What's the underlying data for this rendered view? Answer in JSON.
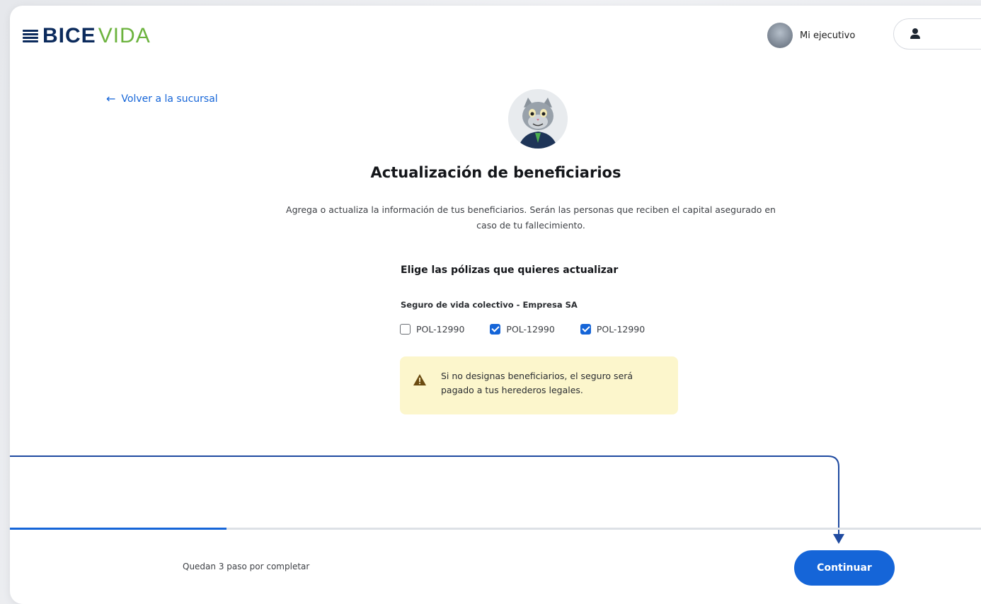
{
  "header": {
    "logo_part1": "BICE",
    "logo_part2": "VIDA",
    "executive_label": "Mi ejecutivo"
  },
  "nav": {
    "back_label": "Volver a la sucursal"
  },
  "main": {
    "title": "Actualización de beneficiarios",
    "description": "Agrega o actualiza la información de tus beneficiarios. Serán las personas que reciben el capital asegurado en caso de tu fallecimiento.",
    "section_title": "Elige las pólizas que quieres actualizar",
    "policy_group": "Seguro de vida colectivo - Empresa SA",
    "policies": [
      {
        "label": "POL-12990",
        "checked": false
      },
      {
        "label": "POL-12990",
        "checked": true
      },
      {
        "label": "POL-12990",
        "checked": true
      }
    ],
    "alert_text": "Si no designas beneficiarios, el seguro será pagado a tus herederos legales."
  },
  "footer": {
    "progress": 0.22,
    "steps_text": "Quedan 3 paso por completar",
    "continue_label": "Continuar"
  },
  "colors": {
    "brand_navy": "#0b2a5c",
    "brand_green": "#6cb33e",
    "accent_blue": "#1565d8",
    "alert_bg": "#fcf6cc",
    "annotation_line": "#1f4aa0"
  },
  "icons": {
    "menu": "menu-icon",
    "user": "user-icon",
    "back": "arrow-left-icon",
    "warning": "warning-icon"
  }
}
